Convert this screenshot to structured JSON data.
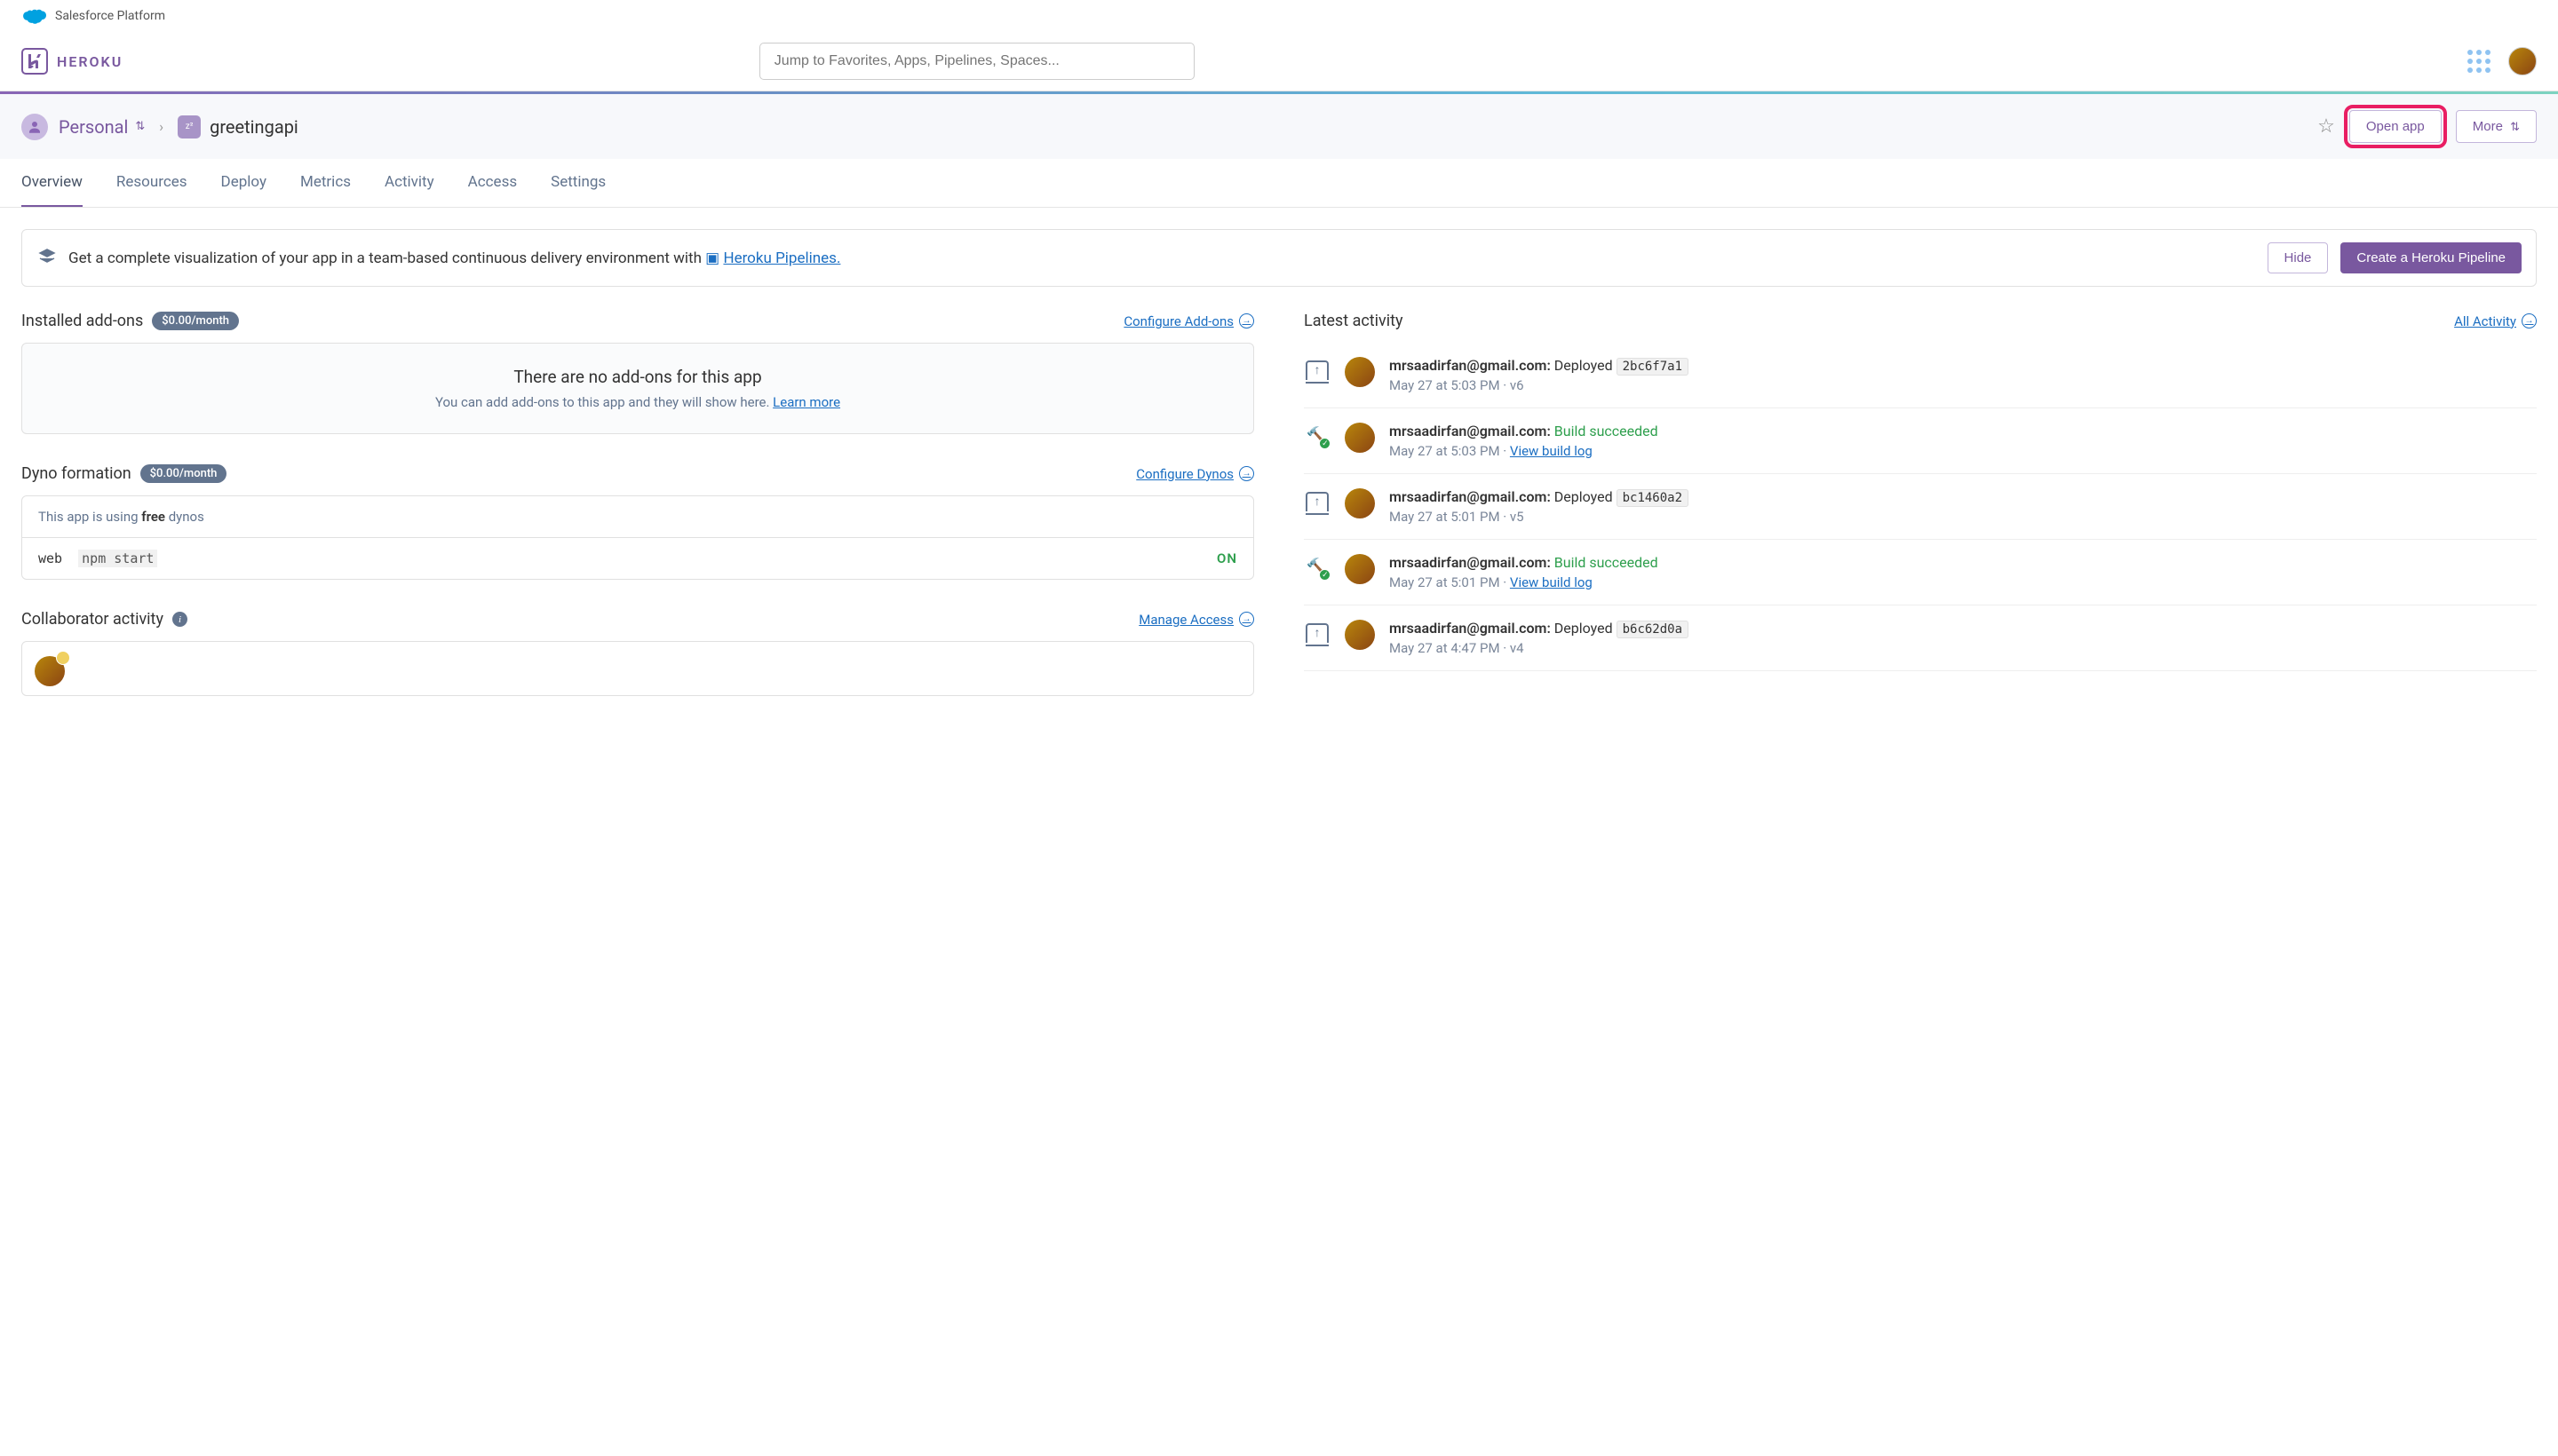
{
  "sf_bar": {
    "label": "Salesforce Platform"
  },
  "header": {
    "logo_text": "HEROKU",
    "search_placeholder": "Jump to Favorites, Apps, Pipelines, Spaces..."
  },
  "breadcrumb": {
    "team": "Personal",
    "app_name": "greetingapi",
    "open_app": "Open app",
    "more": "More"
  },
  "tabs": [
    "Overview",
    "Resources",
    "Deploy",
    "Metrics",
    "Activity",
    "Access",
    "Settings"
  ],
  "banner": {
    "text_pre": "Get a complete visualization of your app in a team-based continuous delivery environment with ",
    "link": "Heroku Pipelines.",
    "hide": "Hide",
    "create": "Create a Heroku Pipeline"
  },
  "addons": {
    "title": "Installed add-ons",
    "price": "$0.00/month",
    "configure": "Configure Add-ons",
    "empty_title": "There are no add-ons for this app",
    "empty_text": "You can add add-ons to this app and they will show here. ",
    "learn_more": "Learn more"
  },
  "dyno": {
    "title": "Dyno formation",
    "price": "$0.00/month",
    "configure": "Configure Dynos",
    "using_pre": "This app is using ",
    "using_strong": "free",
    "using_post": " dynos",
    "proc_type": "web",
    "proc_cmd": "npm start",
    "status": "ON"
  },
  "collab": {
    "title": "Collaborator activity",
    "manage": "Manage Access"
  },
  "activity": {
    "title": "Latest activity",
    "all": "All Activity",
    "items": [
      {
        "type": "deploy",
        "email": "mrsaadirfan@gmail.com:",
        "action": "Deployed",
        "hash": "2bc6f7a1",
        "time": "May 27 at 5:03 PM",
        "version": "v6"
      },
      {
        "type": "build",
        "email": "mrsaadirfan@gmail.com:",
        "action": "Build succeeded",
        "time": "May 27 at 5:03 PM",
        "link": "View build log"
      },
      {
        "type": "deploy",
        "email": "mrsaadirfan@gmail.com:",
        "action": "Deployed",
        "hash": "bc1460a2",
        "time": "May 27 at 5:01 PM",
        "version": "v5"
      },
      {
        "type": "build",
        "email": "mrsaadirfan@gmail.com:",
        "action": "Build succeeded",
        "time": "May 27 at 5:01 PM",
        "link": "View build log"
      },
      {
        "type": "deploy",
        "email": "mrsaadirfan@gmail.com:",
        "action": "Deployed",
        "hash": "b6c62d0a",
        "time": "May 27 at 4:47 PM",
        "version": "v4"
      }
    ]
  }
}
